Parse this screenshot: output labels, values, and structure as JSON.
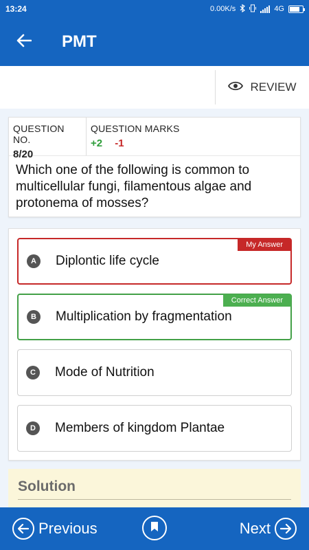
{
  "status_bar": {
    "time": "13:24",
    "network_speed": "0.00K/s",
    "network_type": "4G"
  },
  "app_bar": {
    "title": "PMT",
    "back_icon": "arrow-left-icon"
  },
  "toolbar": {
    "review_label": "REVIEW",
    "review_icon": "eye-icon"
  },
  "question": {
    "number_label": "QUESTION NO.",
    "number_value": "8/20",
    "marks_label": "QUESTION MARKS",
    "marks_positive": "+2",
    "marks_negative": "-1",
    "text": "Which one of the following is common to multicellular fungi, filamentous algae and protonema of mosses?"
  },
  "options": [
    {
      "letter": "A",
      "text": "Diplontic life cycle",
      "tag": "My Answer",
      "state": "wrong"
    },
    {
      "letter": "B",
      "text": "Multiplication by fragmentation",
      "tag": "Correct Answer",
      "state": "correct"
    },
    {
      "letter": "C",
      "text": "Mode of Nutrition",
      "tag": "",
      "state": "none"
    },
    {
      "letter": "D",
      "text": "Members of kingdom Plantae",
      "tag": "",
      "state": "none"
    }
  ],
  "solution": {
    "heading": "Solution"
  },
  "bottom_nav": {
    "previous_label": "Previous",
    "next_label": "Next",
    "bookmark_icon": "bookmark-icon"
  },
  "colors": {
    "primary": "#1565c0",
    "wrong": "#c62828",
    "correct": "#43a047",
    "solution_bg": "#fbf6da"
  }
}
